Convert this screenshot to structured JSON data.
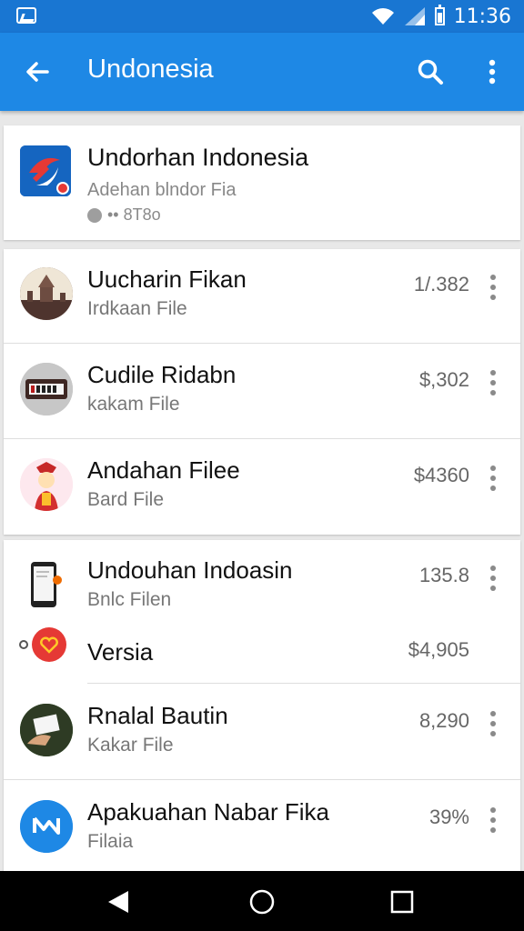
{
  "status_bar": {
    "time": "11:36",
    "icons": [
      "notification-icon",
      "wifi-icon",
      "signal-icon",
      "battery-icon"
    ]
  },
  "app_bar": {
    "title": "Undonesia",
    "back_icon": "arrow-back-icon",
    "search_icon": "search-icon",
    "menu_icon": "more-vert-icon"
  },
  "header_card": {
    "title": "Undorhan Indonesia",
    "subtitle": "Adehan blndor Fia",
    "meta": "•• 8T8o"
  },
  "group1": [
    {
      "title": "Uucharin Fikan",
      "subtitle": "Irdkaan File",
      "value": "1/.382",
      "avatar": "temple-avatar"
    },
    {
      "title": "Cudile Ridabn",
      "subtitle": "kakam File",
      "value": "$,302",
      "avatar": "device-avatar"
    },
    {
      "title": "Andahan Filee",
      "subtitle": "Bard File",
      "value": "$4360",
      "avatar": "dancer-avatar"
    }
  ],
  "group2": [
    {
      "title": "Undouhan Indoasin",
      "subtitle": "Bnlc Filen",
      "value": "135.8",
      "avatar": "phone-avatar"
    },
    {
      "title": "Versia",
      "subtitle": "",
      "value": "$4,905",
      "avatar": "heart-avatar"
    },
    {
      "title": "Rnalal Bautin",
      "subtitle": "Kakar File",
      "value": "8,290",
      "avatar": "hand-avatar"
    },
    {
      "title": "Apakuahan Nabar Fika",
      "subtitle": "Filaia",
      "value": "39%",
      "avatar": "messenger-avatar"
    }
  ],
  "colors": {
    "status_bar": "#1976d2",
    "app_bar": "#1e88e5",
    "background": "#e8e8e8",
    "nav_bar": "#000000"
  }
}
